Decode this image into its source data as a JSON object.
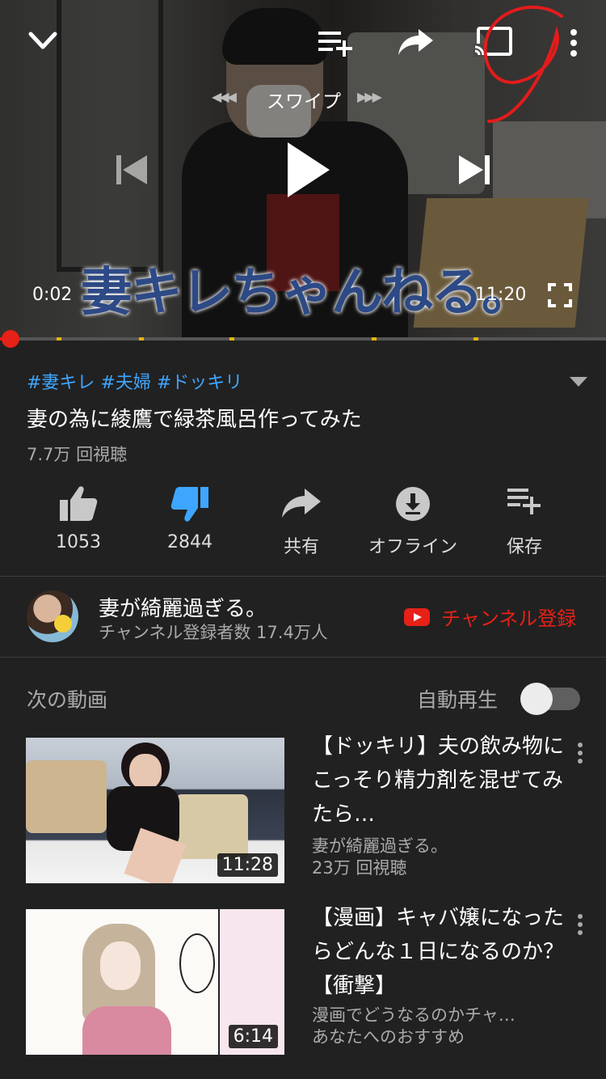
{
  "player": {
    "swipe_label": "スワイプ",
    "current_time": "0:02",
    "duration": "11:20",
    "watermark": "妻キレちゃんねる。",
    "progress_fraction": 0.003
  },
  "video": {
    "tags": "#妻キレ #夫婦 #ドッキリ",
    "title": "妻の為に綾鷹で緑茶風呂作ってみた",
    "views": "7.7万 回視聴"
  },
  "actions": [
    {
      "label": "1053",
      "icon": "thumbs-up-icon"
    },
    {
      "label": "2844",
      "icon": "thumbs-down-icon"
    },
    {
      "label": "共有",
      "icon": "share-icon"
    },
    {
      "label": "オフライン",
      "icon": "download-icon"
    },
    {
      "label": "保存",
      "icon": "playlist-add-icon"
    }
  ],
  "channel": {
    "name": "妻が綺麗過ぎる。",
    "subscribers": "チャンネル登録者数 17.4万人",
    "subscribe_label": "チャンネル登録"
  },
  "up_next": {
    "label": "次の動画",
    "autoplay_label": "自動再生",
    "autoplay_on": false
  },
  "videos": [
    {
      "title": "【ドッキリ】夫の飲み物にこっそり精力剤を混ぜてみたら…",
      "channel": "妻が綺麗過ぎる。",
      "views": "23万 回視聴",
      "duration": "11:28"
    },
    {
      "title": "【漫画】キャバ嬢になったらどんな１日になるのか？【衝撃】",
      "channel": "漫画でどうなるのかチャ…",
      "views": "あなたへのおすすめ",
      "duration": "6:14"
    }
  ],
  "colors": {
    "accent_red": "#e62117",
    "link_blue": "#3ea6ff",
    "background": "#212121"
  }
}
